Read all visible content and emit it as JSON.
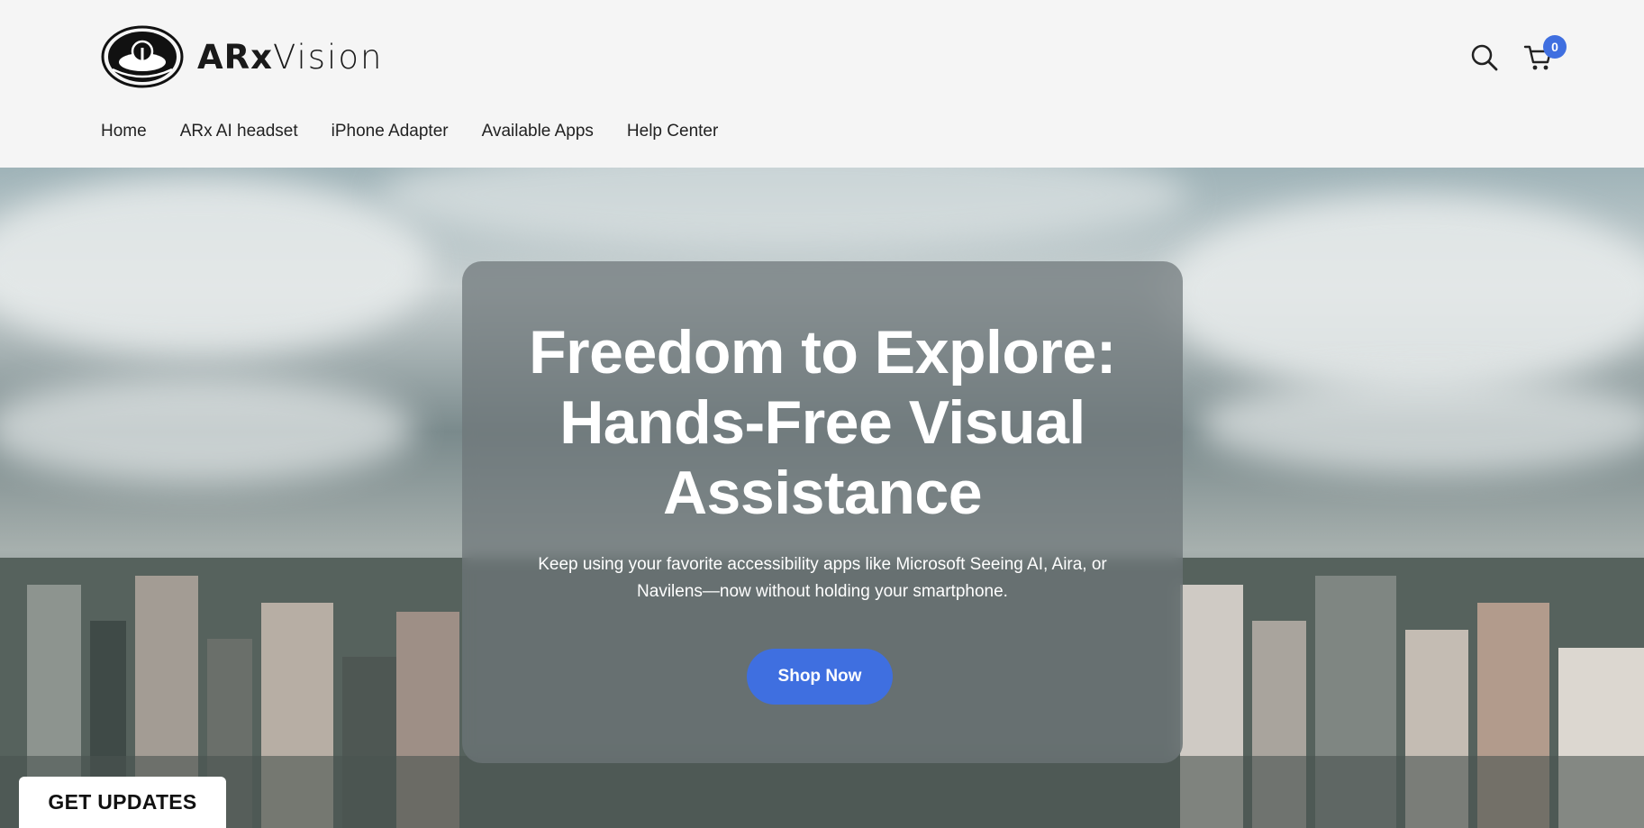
{
  "brand": {
    "name_bold": "ARx",
    "name_light": "Vision",
    "logo_icon": "arx-eye-logo"
  },
  "nav": {
    "items": [
      {
        "label": "Home"
      },
      {
        "label": "ARx AI headset"
      },
      {
        "label": "iPhone Adapter"
      },
      {
        "label": "Available Apps"
      },
      {
        "label": "Help Center"
      }
    ]
  },
  "header_icons": {
    "search_icon": "search-icon",
    "cart_icon": "cart-icon",
    "cart_count": "0"
  },
  "hero": {
    "title_line1": "Freedom to Explore:",
    "title_line2": "Hands-Free Visual",
    "title_line3": "Assistance",
    "subtitle_line1": "Keep using your favorite accessibility apps like Microsoft Seeing AI, Aira, or",
    "subtitle_line2": "Navilens—now without holding your smartphone.",
    "cta_label": "Shop Now"
  },
  "updates_tab": {
    "label": "GET UPDATES"
  },
  "colors": {
    "accent": "#3f6fe0",
    "header_bg": "#f5f5f5"
  }
}
